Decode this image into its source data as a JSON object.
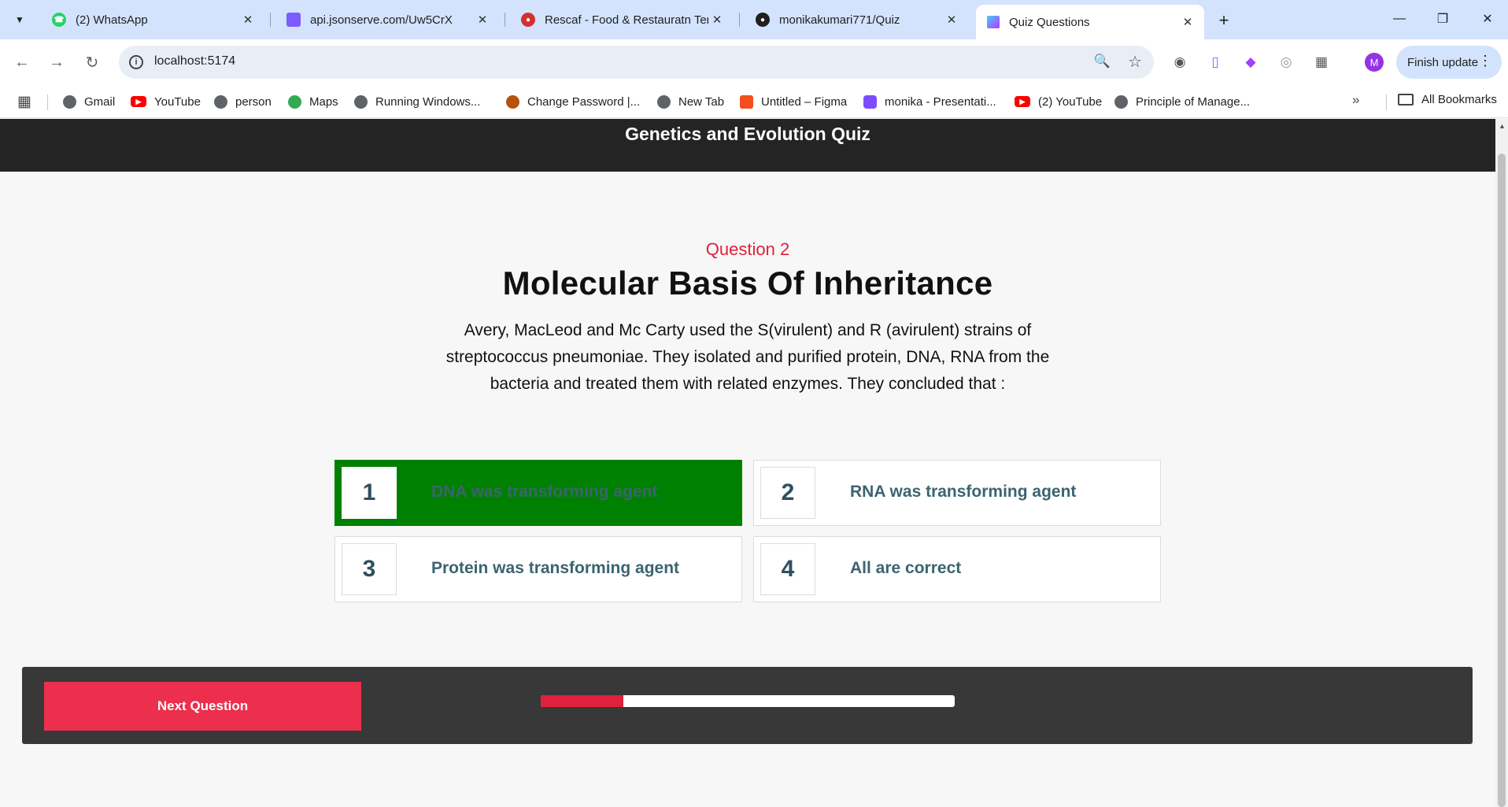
{
  "browser": {
    "tabs": [
      {
        "title": "(2) WhatsApp",
        "icon": "whatsapp-icon",
        "color": "#25d366"
      },
      {
        "title": "api.jsonserve.com/Uw5CrX",
        "icon": "jsonserve-icon",
        "color": "#7c5cff"
      },
      {
        "title": "Rescaf - Food & Restauratn Ten",
        "icon": "rescaf-icon",
        "color": "#d32f2f"
      },
      {
        "title": "monikakumari771/Quiz",
        "icon": "github-icon",
        "color": "#1f1f1f"
      },
      {
        "title": "Quiz Questions",
        "icon": "vite-icon",
        "color": "#a855f7",
        "active": true
      }
    ],
    "address": "localhost:5174",
    "profile_initial": "M",
    "finish_update": "Finish update",
    "bookmarks": [
      {
        "label": "Gmail",
        "icon": "globe-icon"
      },
      {
        "label": "YouTube",
        "icon": "youtube-icon"
      },
      {
        "label": "person",
        "icon": "globe-icon"
      },
      {
        "label": "Maps",
        "icon": "maps-icon"
      },
      {
        "label": "Running Windows...",
        "icon": "globe-icon"
      },
      {
        "label": "Change Password |...",
        "icon": "site-icon"
      },
      {
        "label": "New Tab",
        "icon": "globe-icon"
      },
      {
        "label": "Untitled – Figma",
        "icon": "figma-icon"
      },
      {
        "label": "monika - Presentati...",
        "icon": "presentation-icon"
      },
      {
        "label": "(2) YouTube",
        "icon": "youtube-icon"
      },
      {
        "label": "Principle of Manage...",
        "icon": "globe-icon"
      }
    ],
    "all_bookmarks": "All Bookmarks"
  },
  "quiz": {
    "title": "Genetics and Evolution Quiz",
    "question_number": "Question 2",
    "topic": "Molecular Basis Of Inheritance",
    "question_text": "Avery, MacLeod and Mc Carty used the S(virulent) and R (avirulent) strains of streptococcus pneumoniae. They isolated and purified protein, DNA, RNA from the bacteria and treated them with related enzymes. They concluded that :",
    "options": [
      {
        "number": "1",
        "text": "DNA was transforming agent",
        "selected": true
      },
      {
        "number": "2",
        "text": "RNA was transforming agent",
        "selected": false
      },
      {
        "number": "3",
        "text": "Protein was transforming agent",
        "selected": false
      },
      {
        "number": "4",
        "text": "All are correct",
        "selected": false
      }
    ],
    "next_button": "Next Question",
    "progress_fraction": 0.2,
    "colors": {
      "accent": "#e0203d",
      "selected": "#008000",
      "header": "#242424",
      "footer": "#383838"
    }
  }
}
